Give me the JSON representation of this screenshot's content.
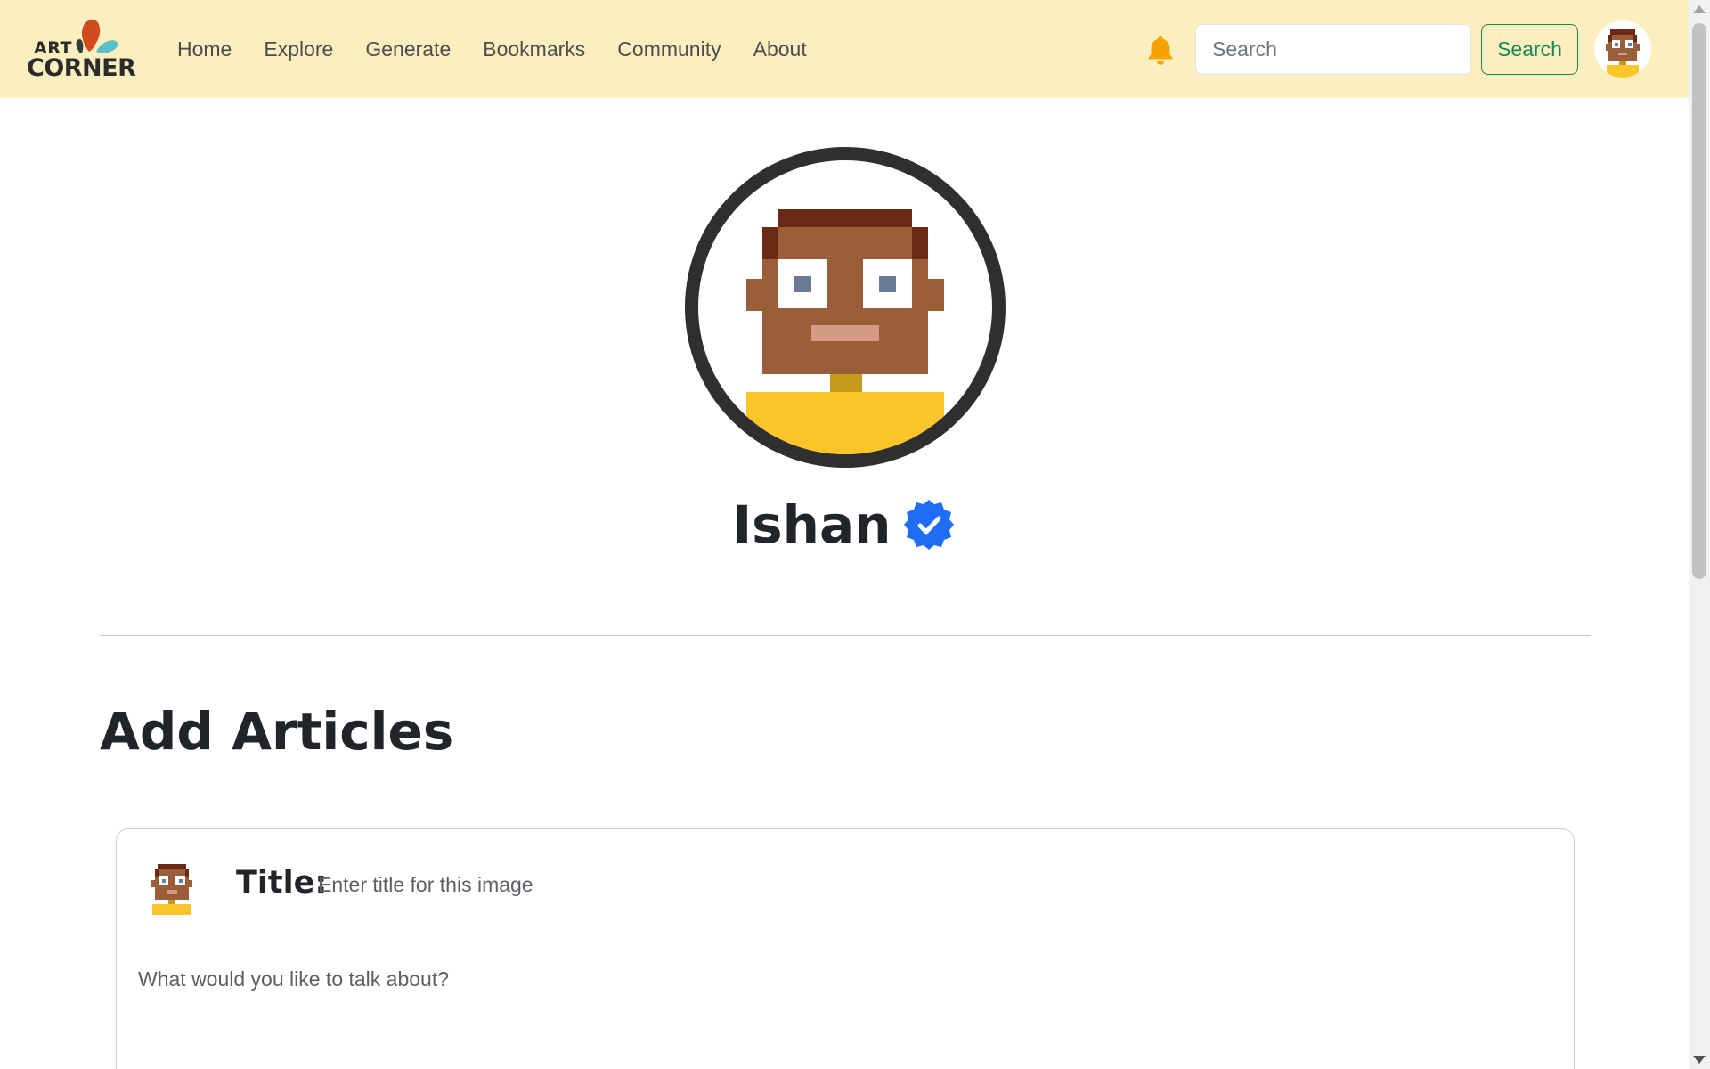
{
  "brand": {
    "line1": "ART",
    "line2": "CORNER",
    "colors": {
      "petal_orange": "#d24b1e",
      "petal_teal": "#5bbfc8",
      "petal_dark": "#3a3a3a"
    }
  },
  "nav": {
    "items": [
      {
        "label": "Home"
      },
      {
        "label": "Explore"
      },
      {
        "label": "Generate"
      },
      {
        "label": "Bookmarks"
      },
      {
        "label": "Community"
      },
      {
        "label": "About"
      }
    ],
    "bell_icon": "bell-icon",
    "search": {
      "placeholder": "Search",
      "value": "",
      "button_label": "Search"
    }
  },
  "profile": {
    "name": "Ishan",
    "verified": true,
    "verified_icon": "verified-badge-icon"
  },
  "section": {
    "title": "Add Articles"
  },
  "article_form": {
    "title_label": "Title:",
    "title_placeholder": "Enter title for this image",
    "body_placeholder": "What would you like to talk about?"
  },
  "colors": {
    "navbar_bg": "#fcefbf",
    "bell": "#f5a300",
    "search_button": "#198754",
    "verified_badge": "#1d6ef5",
    "avatar_skin": "#9a5f38",
    "avatar_hair": "#6b2a16",
    "avatar_shirt": "#fcc52a",
    "avatar_eyes": "#6b7b96",
    "avatar_mouth": "#d39b86",
    "avatar_neck": "#c59a1c"
  }
}
